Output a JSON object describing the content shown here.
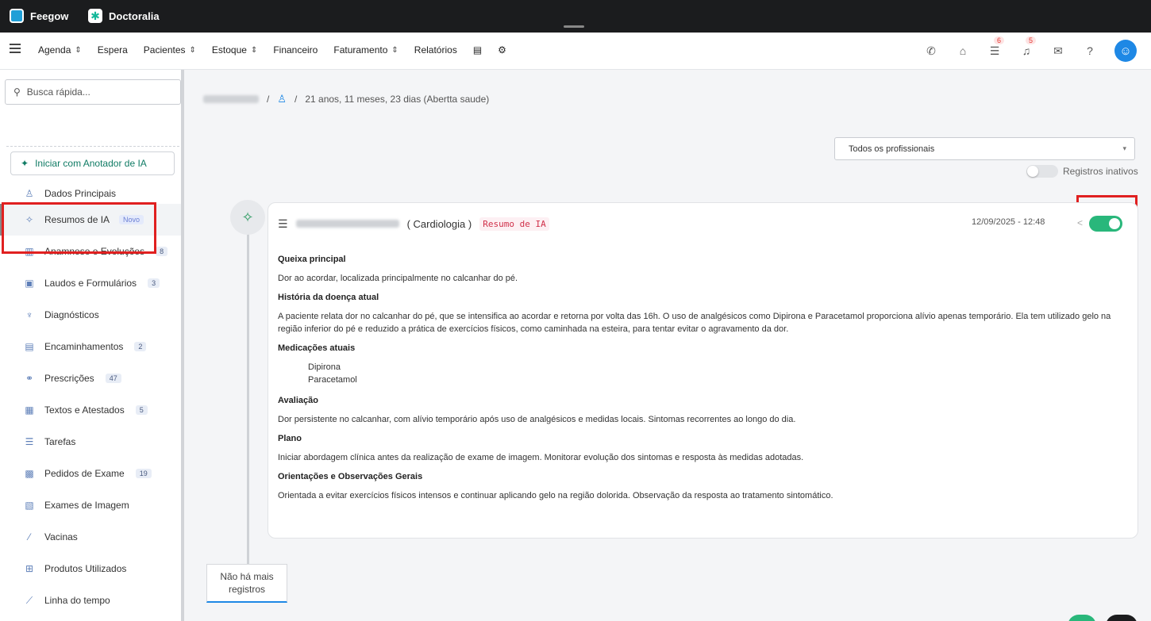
{
  "apps": [
    {
      "label": "Feegow"
    },
    {
      "label": "Doctoralia"
    }
  ],
  "nav": {
    "items": [
      {
        "label": "Agenda",
        "dropdown": true
      },
      {
        "label": "Espera",
        "dropdown": false
      },
      {
        "label": "Pacientes",
        "dropdown": true
      },
      {
        "label": "Estoque",
        "dropdown": true
      },
      {
        "label": "Financeiro",
        "dropdown": false
      },
      {
        "label": "Faturamento",
        "dropdown": true
      },
      {
        "label": "Relatórios",
        "dropdown": false
      }
    ],
    "tasks_badge": "6",
    "notifications_badge": "5"
  },
  "sidebar": {
    "search_placeholder": "Busca rápida...",
    "ai_button": "Iniciar com Anotador de IA",
    "items": [
      {
        "label": "Dados Principais",
        "icon": "user-icon"
      },
      {
        "label": "Resumos de IA",
        "badge": "Novo",
        "icon": "sparkle-icon"
      },
      {
        "label": "Anamnese e Evoluções",
        "count": "8",
        "icon": "chart-icon"
      },
      {
        "label": "Laudos e Formulários",
        "count": "3",
        "icon": "clipboard-icon"
      },
      {
        "label": "Diagnósticos",
        "icon": "stethoscope-icon"
      },
      {
        "label": "Encaminhamentos",
        "count": "2",
        "icon": "document-icon"
      },
      {
        "label": "Prescrições",
        "count": "47",
        "icon": "pills-icon"
      },
      {
        "label": "Textos e Atestados",
        "count": "5",
        "icon": "file-text-icon"
      },
      {
        "label": "Tarefas",
        "icon": "list-icon"
      },
      {
        "label": "Pedidos de Exame",
        "count": "19",
        "icon": "lab-icon"
      },
      {
        "label": "Exames de Imagem",
        "icon": "image-icon"
      },
      {
        "label": "Vacinas",
        "icon": "syringe-icon"
      },
      {
        "label": "Produtos Utilizados",
        "icon": "box-icon"
      },
      {
        "label": "Linha do tempo",
        "icon": "timeline-icon"
      }
    ]
  },
  "patient": {
    "age_info": "21 anos, 11 meses, 23 dias (Abertta saude)"
  },
  "filters": {
    "professional_select": "Todos os profissionais",
    "inactive_label": "Registros inativos"
  },
  "record": {
    "specialty": "( Cardiologia )",
    "tag": "Resumo de IA",
    "datetime": "12/09/2025 - 12:48",
    "active": true,
    "sections": {
      "queixa_title": "Queixa principal",
      "queixa_text": "Dor ao acordar, localizada principalmente no calcanhar do pé.",
      "historia_title": "História da doença atual",
      "historia_text": "A paciente relata dor no calcanhar do pé, que se intensifica ao acordar e retorna por volta das 16h. O uso de analgésicos como Dipirona e Paracetamol proporciona alívio apenas temporário. Ela tem utilizado gelo na região inferior do pé e reduzido a prática de exercícios físicos, como caminhada na esteira, para tentar evitar o agravamento da dor.",
      "medicacoes_title": "Medicações atuais",
      "med_1": "Dipirona",
      "med_2": "Paracetamol",
      "avaliacao_title": "Avaliação",
      "avaliacao_text": "Dor persistente no calcanhar, com alívio temporário após uso de analgésicos e medidas locais. Sintomas recorrentes ao longo do dia.",
      "plano_title": "Plano",
      "plano_text": "Iniciar abordagem clínica antes da realização de exame de imagem. Monitorar evolução dos sintomas e resposta às medidas adotadas.",
      "orientacoes_title": "Orientações e Observações Gerais",
      "orientacoes_text": "Orientada a evitar exercícios físicos intensos e continuar aplicando gelo na região dolorida. Observação da resposta ao tratamento sintomático."
    }
  },
  "no_more_records": "Não há mais registros",
  "colors": {
    "accent_blue": "#1e88e5",
    "toggle_green": "#29b77b",
    "highlight_red": "#e02020",
    "ai_tag_red": "#d0304a"
  }
}
